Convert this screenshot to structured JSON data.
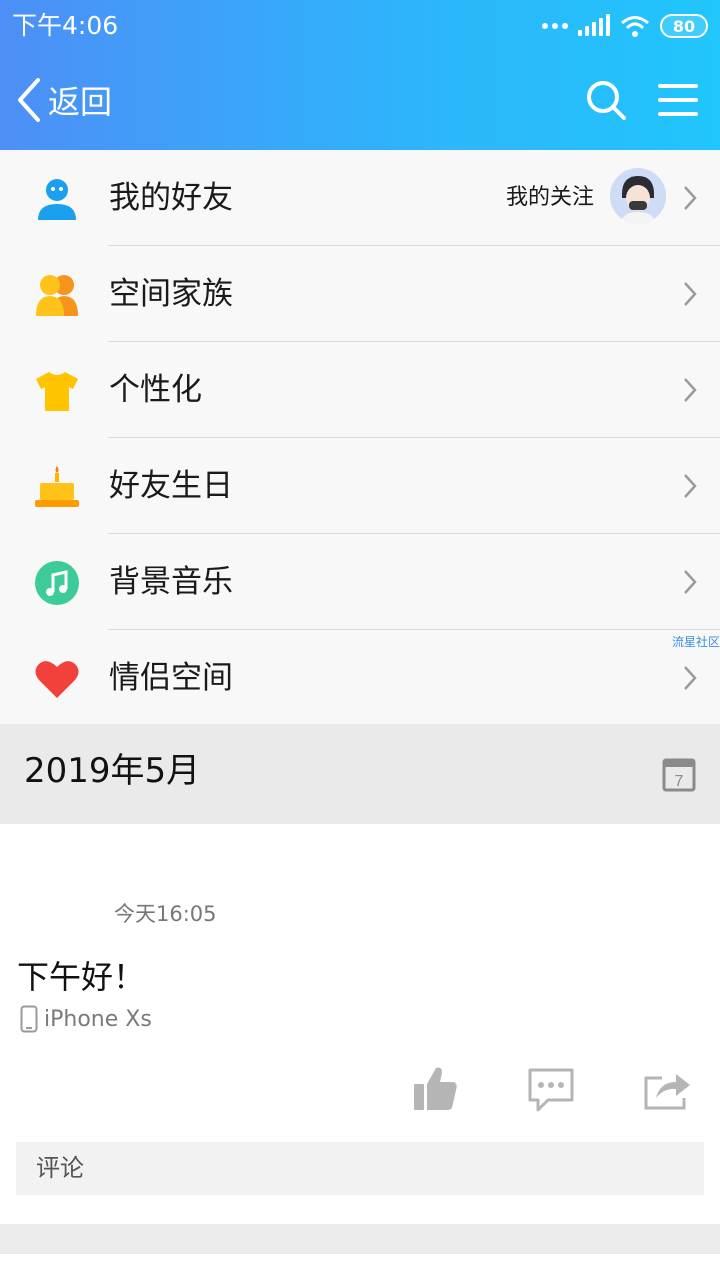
{
  "status_bar": {
    "time": "下午4:06",
    "battery": "80"
  },
  "nav": {
    "back_label": "返回"
  },
  "menu": {
    "items": [
      {
        "label": "我的好友",
        "icon": "friend-icon"
      },
      {
        "label": "空间家族",
        "icon": "family-icon"
      },
      {
        "label": "个性化",
        "icon": "tshirt-icon"
      },
      {
        "label": "好友生日",
        "icon": "cake-icon"
      },
      {
        "label": "背景音乐",
        "icon": "music-icon"
      },
      {
        "label": "情侣空间",
        "icon": "heart-icon"
      }
    ],
    "follow_label": "我的关注",
    "watermark": "流星社区"
  },
  "month": {
    "label": "2019年5月",
    "calendar_day": "7"
  },
  "post": {
    "time": "今天16:05",
    "text": "下午好！",
    "device": "iPhone Xs",
    "comment_placeholder": "评论"
  },
  "colors": {
    "header_start": "#4d8ff6",
    "header_end": "#20c6fc",
    "friend": "#1aa0ef",
    "family": "#f5a623",
    "tshirt": "#ffc300",
    "cake": "#ffb400",
    "music": "#3dcc97",
    "heart": "#f2413a"
  }
}
